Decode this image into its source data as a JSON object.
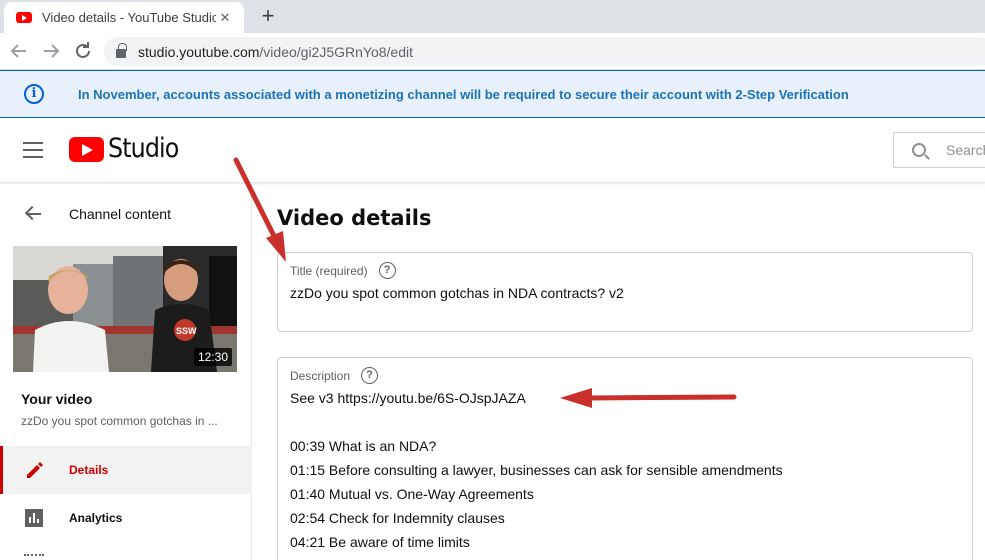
{
  "browser": {
    "tab_title": "Video details - YouTube Studio",
    "tab_close": "✕",
    "new_tab": "+",
    "url_host": "studio.youtube.com",
    "url_path": "/video/gi2J5GRnYo8/edit"
  },
  "banner": {
    "text": "In November, accounts associated with a monetizing channel will be required to secure their account with 2-Step Verification"
  },
  "header": {
    "logo_text": "Studio",
    "search_placeholder": "Search"
  },
  "sidebar": {
    "back_label": "Channel content",
    "thumbnail_duration": "12:30",
    "your_video_label": "Your video",
    "video_title_truncated": "zzDo you spot common gotchas in ...",
    "nav": [
      {
        "label": "Details",
        "active": true
      },
      {
        "label": "Analytics",
        "active": false
      }
    ]
  },
  "main": {
    "page_title": "Video details",
    "title_field": {
      "label": "Title (required)",
      "value": "zzDo you spot common gotchas in NDA contracts? v2"
    },
    "description_field": {
      "label": "Description",
      "lines": [
        "See v3 https://youtu.be/6S-OJspJAZA",
        "",
        "00:39 What is an NDA?",
        "01:15 Before consulting a lawyer, businesses can ask for sensible amendments",
        "01:40 Mutual vs. One-Way Agreements",
        "02:54 Check for Indemnity clauses",
        "04:21 Be aware of time limits"
      ]
    }
  },
  "colors": {
    "youtube_red": "#ff0000",
    "banner_blue": "#065fd4",
    "annotation_arrow": "#c9302c"
  }
}
